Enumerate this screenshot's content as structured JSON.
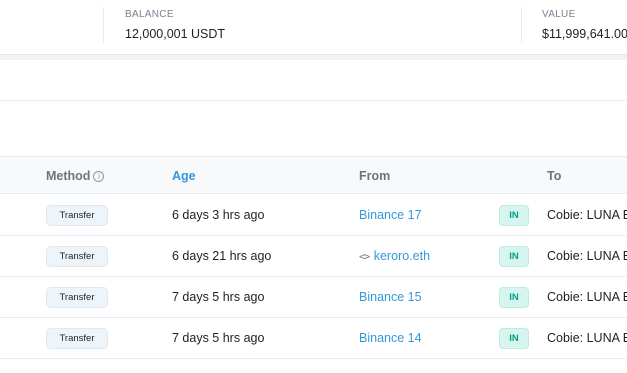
{
  "summary": {
    "balance": {
      "label": "BALANCE",
      "value": "12,000,001 USDT"
    },
    "value": {
      "label": "VALUE",
      "value": "$11,999,641.00"
    }
  },
  "table": {
    "headers": {
      "method": "Method",
      "age": "Age",
      "from": "From",
      "to": "To"
    },
    "info_icon": "ⓘ",
    "rows": [
      {
        "method": "Transfer",
        "age": "6 days 3 hrs ago",
        "from": "Binance 17",
        "from_is_contract": false,
        "direction": "IN",
        "to": "Cobie: LUNA Bet"
      },
      {
        "method": "Transfer",
        "age": "6 days 21 hrs ago",
        "from": "keroro.eth",
        "from_is_contract": true,
        "direction": "IN",
        "to": "Cobie: LUNA Bet"
      },
      {
        "method": "Transfer",
        "age": "7 days 5 hrs ago",
        "from": "Binance 15",
        "from_is_contract": false,
        "direction": "IN",
        "to": "Cobie: LUNA Bet"
      },
      {
        "method": "Transfer",
        "age": "7 days 5 hrs ago",
        "from": "Binance 14",
        "from_is_contract": false,
        "direction": "IN",
        "to": "Cobie: LUNA Bet"
      }
    ]
  },
  "icons": {
    "contract": "code-icon",
    "info": "info-icon"
  },
  "colors": {
    "link": "#3498db",
    "in_badge_bg": "#d6f5ee",
    "in_badge_text": "#00a186",
    "header_bg": "#f8f9fa"
  }
}
